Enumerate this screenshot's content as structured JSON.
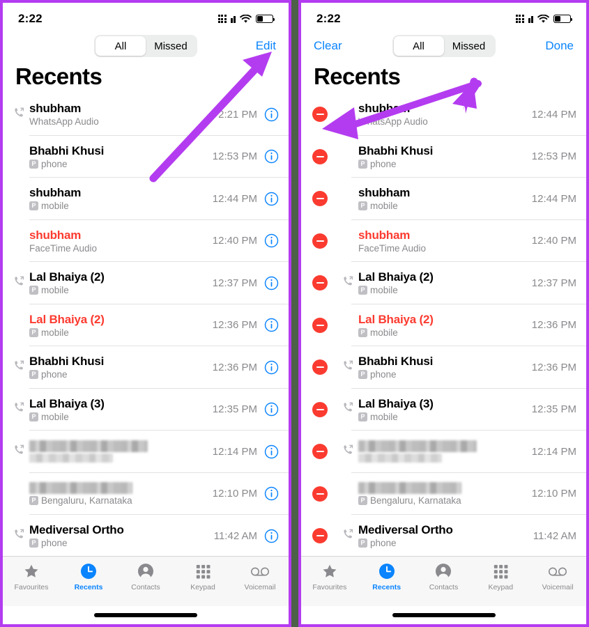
{
  "accent": {
    "blue": "#0a84ff",
    "red": "#fc3b30",
    "arrow_purple": "#b43cf0",
    "gray": "#8a8a8e"
  },
  "status_bar": {
    "time": "2:22",
    "cellular_icon": "cellular-bars-icon",
    "wifi_icon": "wifi-icon",
    "battery_icon": "battery-low-icon"
  },
  "segmented": {
    "options": [
      "All",
      "Missed"
    ],
    "selected": "All"
  },
  "page_title": "Recents",
  "left_panel": {
    "nav": {
      "left_label": "",
      "right_label": "Edit"
    },
    "edit_mode": false
  },
  "right_panel": {
    "nav": {
      "left_label": "Clear",
      "right_label": "Done"
    },
    "edit_mode": true
  },
  "tabbar": {
    "items": [
      {
        "label": "Favourites",
        "icon": "star-icon",
        "active": false
      },
      {
        "label": "Recents",
        "icon": "clock-icon",
        "active": true
      },
      {
        "label": "Contacts",
        "icon": "person-circle-icon",
        "active": false
      },
      {
        "label": "Keypad",
        "icon": "keypad-grid-icon",
        "active": false
      },
      {
        "label": "Voicemail",
        "icon": "voicemail-icon",
        "active": false
      }
    ]
  },
  "left_calls": [
    {
      "name": "shubham",
      "sub": "WhatsApp Audio",
      "sim": false,
      "time": "2:21 PM",
      "missed": false,
      "outgoing": true,
      "redacted": false
    },
    {
      "name": "Bhabhi Khusi",
      "sub": "phone",
      "sim": true,
      "time": "12:53 PM",
      "missed": false,
      "outgoing": false,
      "redacted": false
    },
    {
      "name": "shubham",
      "sub": "mobile",
      "sim": true,
      "time": "12:44 PM",
      "missed": false,
      "outgoing": false,
      "redacted": false
    },
    {
      "name": "shubham",
      "sub": "FaceTime Audio",
      "sim": false,
      "time": "12:40 PM",
      "missed": true,
      "outgoing": false,
      "redacted": false
    },
    {
      "name": "Lal Bhaiya (2)",
      "sub": "mobile",
      "sim": true,
      "time": "12:37 PM",
      "missed": false,
      "outgoing": true,
      "redacted": false
    },
    {
      "name": "Lal Bhaiya (2)",
      "sub": "mobile",
      "sim": true,
      "time": "12:36 PM",
      "missed": true,
      "outgoing": false,
      "redacted": false
    },
    {
      "name": "Bhabhi Khusi",
      "sub": "phone",
      "sim": true,
      "time": "12:36 PM",
      "missed": false,
      "outgoing": true,
      "redacted": false
    },
    {
      "name": "Lal Bhaiya (3)",
      "sub": "mobile",
      "sim": true,
      "time": "12:35 PM",
      "missed": false,
      "outgoing": true,
      "redacted": false
    },
    {
      "name": "",
      "sub": "",
      "sim": false,
      "time": "12:14 PM",
      "missed": false,
      "outgoing": true,
      "redacted": true
    },
    {
      "name": "",
      "sub": "Bengaluru, Karnataka",
      "sim": true,
      "time": "12:10 PM",
      "missed": false,
      "outgoing": false,
      "redacted": true
    },
    {
      "name": "Mediversal Ortho",
      "sub": "phone",
      "sim": true,
      "time": "11:42 AM",
      "missed": false,
      "outgoing": true,
      "redacted": false
    }
  ],
  "right_calls": [
    {
      "name": "shubham",
      "sub": "WhatsApp Audio",
      "sim": false,
      "time": "12:44 PM",
      "missed": false,
      "outgoing": false,
      "redacted": false
    },
    {
      "name": "Bhabhi Khusi",
      "sub": "phone",
      "sim": true,
      "time": "12:53 PM",
      "missed": false,
      "outgoing": false,
      "redacted": false
    },
    {
      "name": "shubham",
      "sub": "mobile",
      "sim": true,
      "time": "12:44 PM",
      "missed": false,
      "outgoing": false,
      "redacted": false
    },
    {
      "name": "shubham",
      "sub": "FaceTime Audio",
      "sim": false,
      "time": "12:40 PM",
      "missed": true,
      "outgoing": false,
      "redacted": false
    },
    {
      "name": "Lal Bhaiya (2)",
      "sub": "mobile",
      "sim": true,
      "time": "12:37 PM",
      "missed": false,
      "outgoing": true,
      "redacted": false
    },
    {
      "name": "Lal Bhaiya (2)",
      "sub": "mobile",
      "sim": true,
      "time": "12:36 PM",
      "missed": true,
      "outgoing": false,
      "redacted": false
    },
    {
      "name": "Bhabhi Khusi",
      "sub": "phone",
      "sim": true,
      "time": "12:36 PM",
      "missed": false,
      "outgoing": true,
      "redacted": false
    },
    {
      "name": "Lal Bhaiya (3)",
      "sub": "mobile",
      "sim": true,
      "time": "12:35 PM",
      "missed": false,
      "outgoing": true,
      "redacted": false
    },
    {
      "name": "",
      "sub": "",
      "sim": false,
      "time": "12:14 PM",
      "missed": false,
      "outgoing": true,
      "redacted": true
    },
    {
      "name": "",
      "sub": "Bengaluru, Karnataka",
      "sim": true,
      "time": "12:10 PM",
      "missed": false,
      "outgoing": false,
      "redacted": true
    },
    {
      "name": "Mediversal Ortho",
      "sub": "phone",
      "sim": true,
      "time": "11:42 AM",
      "missed": false,
      "outgoing": true,
      "redacted": false
    }
  ],
  "annotations": [
    {
      "name": "arrow-pointing-to-edit-button",
      "panel": "left"
    },
    {
      "name": "arrow-pointing-to-delete-button",
      "panel": "right"
    }
  ]
}
